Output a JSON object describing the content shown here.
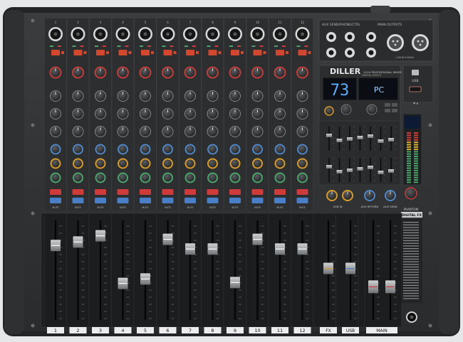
{
  "brand": {
    "logo": "DILLER",
    "tagline": "12CH PROFESSIONAL MIXER"
  },
  "top_sections": {
    "aux_send": "AUX SEND/PHONE/CTRL",
    "main_outputs": "MAIN OUTPUTS",
    "outputs": "L-MAIN  R-MAIN"
  },
  "channels": {
    "labels": [
      "1",
      "2",
      "3",
      "4",
      "5",
      "6",
      "7",
      "8",
      "9",
      "10",
      "11",
      "12"
    ],
    "fader_positions": [
      0.78,
      0.82,
      0.89,
      0.35,
      0.4,
      0.85,
      0.74,
      0.74,
      0.36,
      0.85,
      0.74,
      0.74
    ],
    "mute_label": "MUTE"
  },
  "strip_labels": [
    "FX",
    "USB",
    "MAIN"
  ],
  "fx_display": {
    "number": "73",
    "mode": "PC",
    "title": "DIGITAL EFFECT"
  },
  "usb": {
    "label": "USB"
  },
  "phantom": {
    "label": "PHANTOM"
  },
  "digital_fx": {
    "label": "DIGITAL FX"
  },
  "knob_section": {
    "labels": [
      "USB IN",
      "AUX RETURN",
      "AUX SEND"
    ]
  },
  "colors": {
    "chassis": "#262728",
    "panel": "#2f3133",
    "fader_bay": "#1c1d1e",
    "knob_red": "#c43d3a",
    "knob_blue": "#4f86c6",
    "knob_orange": "#d89b2a",
    "knob_green": "#4aa46a",
    "mute_red": "#cf3b3b",
    "mute_blue": "#4a7ec6",
    "display_blue": "#5aaeff"
  }
}
